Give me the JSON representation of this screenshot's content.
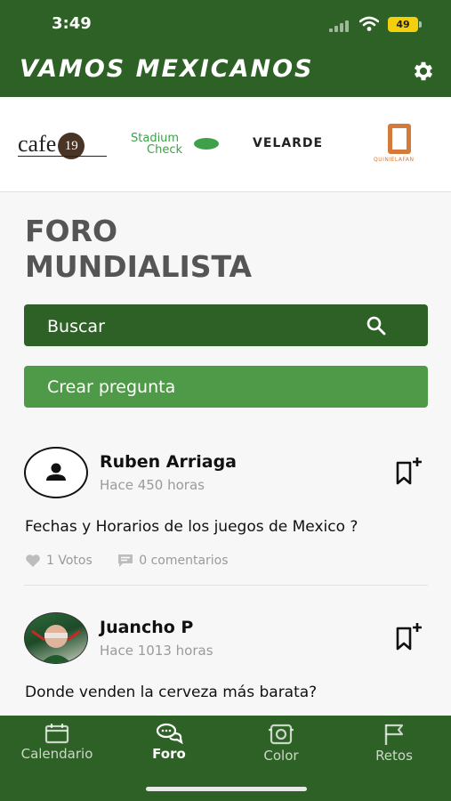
{
  "status_bar": {
    "time": "3:49",
    "battery": "49"
  },
  "header": {
    "title": "VAMOS MEXICANOS",
    "settings_icon": "gear-icon"
  },
  "sponsors": {
    "cafe": "cafe",
    "cafe_number": "19",
    "stadium_line1": "Stadium",
    "stadium_line2": "Check",
    "velarde": "VELARDE",
    "quiniela": "QUINIELAFAN"
  },
  "page": {
    "title_line1": "FORO",
    "title_line2": "MUNDIALISTA"
  },
  "search": {
    "label": "Buscar",
    "icon": "search-icon"
  },
  "create": {
    "label": "Crear pregunta"
  },
  "posts": [
    {
      "author": "Ruben  Arriaga",
      "time": "Hace 450 horas",
      "question": "Fechas y Horarios de los juegos de Mexico ?",
      "votes": "1 Votos",
      "comments": "0 comentarios"
    },
    {
      "author": "Juancho P",
      "time": "Hace 1013 horas",
      "question": "Donde venden la cerveza más barata?"
    }
  ],
  "tabs": [
    {
      "label": "Calendario",
      "icon": "calendar-icon"
    },
    {
      "label": "Foro",
      "icon": "chat-icon",
      "active": true
    },
    {
      "label": "Color",
      "icon": "stadium-icon"
    },
    {
      "label": "Retos",
      "icon": "flag-icon"
    }
  ],
  "colors": {
    "primary": "#2e6125",
    "accent": "#4f9a48",
    "battery": "#f3cf0e"
  }
}
